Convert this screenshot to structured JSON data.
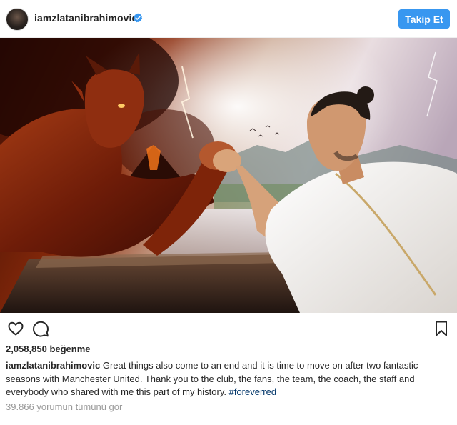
{
  "post": {
    "username": "iamzlatanibrahimovic",
    "verified_icon": "verified-badge-icon",
    "follow_label": "Takip Et",
    "likes_text": "2,058,850 beğenme",
    "caption_username": "iamzlatanibrahimovic",
    "caption_text": " Great things also come to an end and it is time to move on after two fantastic seasons with Manchester United. Thank you to the club, the fans, the team, the coach, the staff and everybody who shared with me this part of my history. ",
    "hashtag": "#foreverred",
    "comments_link": "39.866 yorumun tümünü gör"
  },
  "icons": {
    "like": "heart-icon",
    "comment": "comment-icon",
    "save": "bookmark-icon"
  },
  "colors": {
    "accent": "#3897f0",
    "hashtag": "#003569",
    "muted": "#999999",
    "text": "#262626"
  }
}
